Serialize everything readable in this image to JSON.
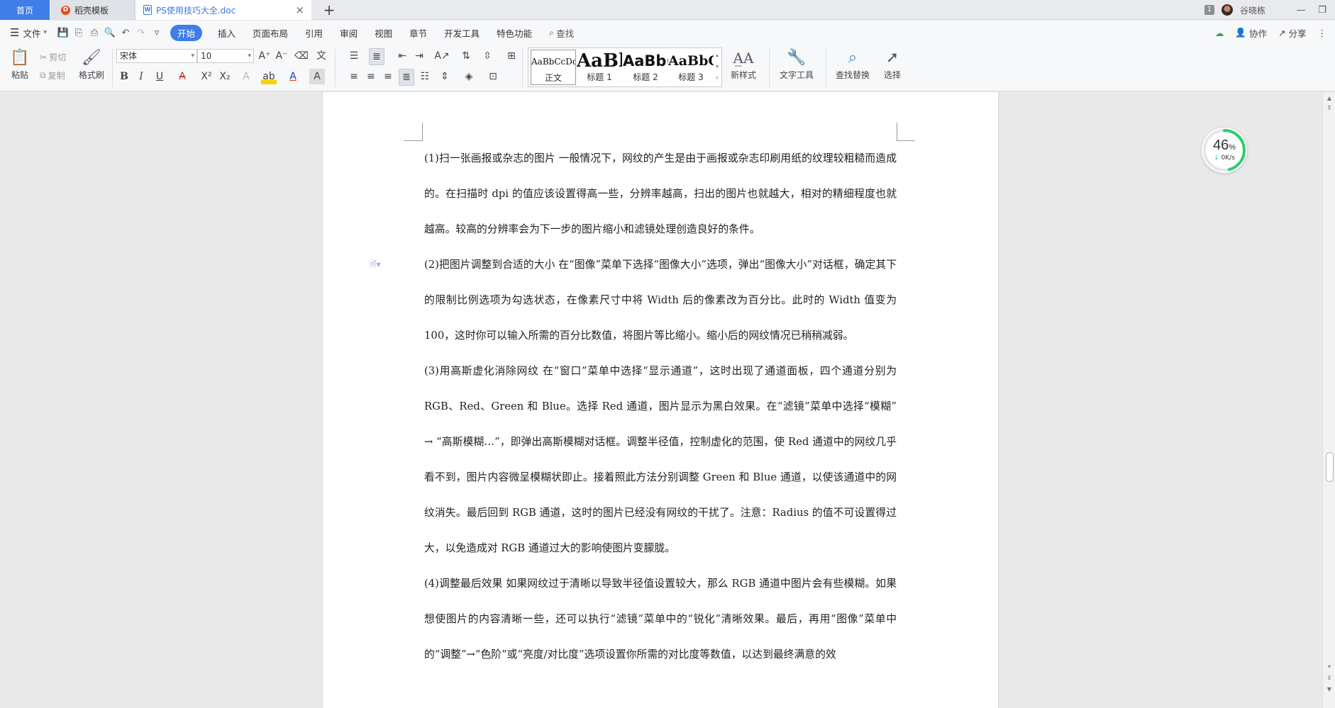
{
  "tabs": {
    "home": "首页",
    "templates": "稻壳模板",
    "document": "PS使用技巧大全.doc",
    "add": "+",
    "close": "×"
  },
  "window": {
    "badge": "1",
    "username": "谷晓栋",
    "minimize": "—",
    "restore": "❐"
  },
  "menu": {
    "file": "文件",
    "items": [
      "开始",
      "插入",
      "页面布局",
      "引用",
      "审阅",
      "视图",
      "章节",
      "开发工具",
      "特色功能"
    ],
    "search": "查找",
    "collab": "协作",
    "share": "分享"
  },
  "ribbon": {
    "paste": "粘贴",
    "cut": "剪切",
    "copy": "复制",
    "format_painter": "格式刷",
    "font_name": "宋体",
    "font_size": "10",
    "styles": [
      {
        "sample": "AaBbCcDd",
        "name": "正文"
      },
      {
        "sample": "AaBl",
        "name": "标题 1"
      },
      {
        "sample": "AaBb(",
        "name": "标题 2"
      },
      {
        "sample": "AaBbC",
        "name": "标题 3"
      }
    ],
    "new_style": "新样式",
    "text_tools": "文字工具",
    "find_replace": "查找替换",
    "select": "选择"
  },
  "speed": {
    "percent": "46",
    "percent_unit": "%",
    "rate": "0K/s",
    "fraction": 0.46
  },
  "document": {
    "paragraphs": [
      "(1)扫一张画报或杂志的图片 一般情况下，网纹的产生是由于画报或杂志印刷用纸的纹理较粗糙而造成的。在扫描时 dpi 的值应该设置得高一些，分辨率越高，扫出的图片也就越大，相对的精细程度也就越高。较高的分辨率会为下一步的图片缩小和滤镜处理创造良好的条件。",
      "(2)把图片调整到合适的大小 在“图像”菜单下选择“图像大小”选项，弹出“图像大小”对话框，确定其下的限制比例选项为勾选状态，在像素尺寸中将 Width 后的像素改为百分比。此时的 Width 值变为 100，这时你可以输入所需的百分比数值，将图片等比缩小。缩小后的网纹情况已稍稍减弱。",
      "(3)用高斯虚化消除网纹 在“窗口”菜单中选择“显示通道”，这时出现了通道面板，四个通道分别为 RGB、Red、Green 和 Blue。选择 Red 通道，图片显示为黑白效果。在“滤镜”菜单中选择“模糊” → “高斯模糊…”，即弹出高斯模糊对话框。调整半径值，控制虚化的范围，使 Red 通道中的网纹几乎看不到，图片内容微呈模糊状即止。接着照此方法分别调整 Green 和 Blue 通道，以使该通道中的网纹消失。最后回到 RGB 通道，这时的图片已经没有网纹的干扰了。注意：Radius 的值不可设置得过大，以免造成对 RGB 通道过大的影响使图片变朦胧。",
      "(4)调整最后效果 如果网纹过于清晰以导致半径值设置较大，那么 RGB 通道中图片会有些模糊。如果想使图片的内容清晰一些，还可以执行“滤镜”菜单中的“锐化”清晰效果。最后，再用“图像”菜单中的“调整”→“色阶”或“亮度/对比度”选项设置你所需的对比度等数值，以达到最终满意的效"
    ]
  },
  "colors": {
    "accent": "#3f7de8",
    "speed_ring": "#2ecc71"
  }
}
